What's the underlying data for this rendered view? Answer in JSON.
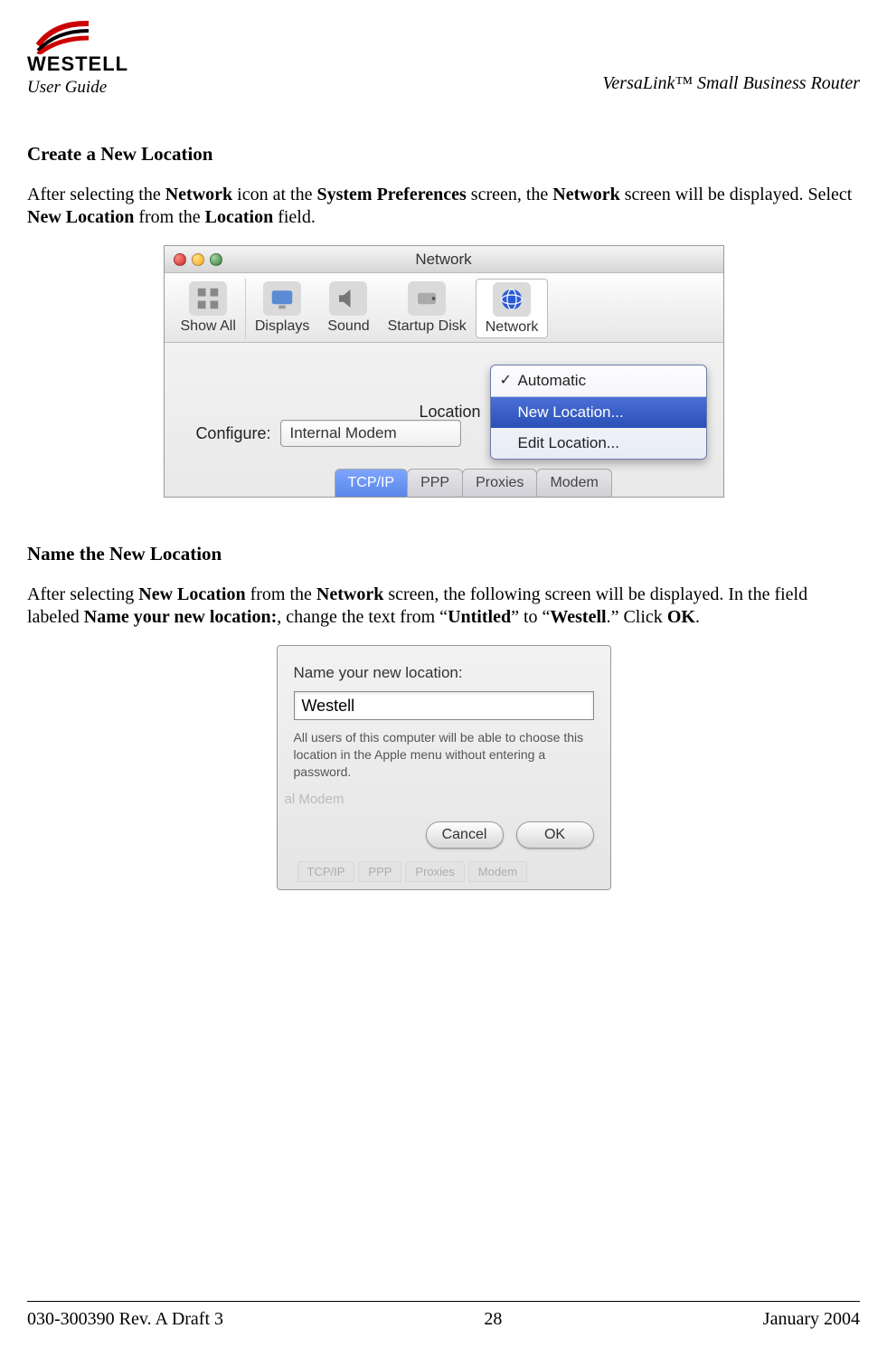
{
  "header": {
    "brand": "WESTELL",
    "userGuide": " User Guide",
    "product": "VersaLink™  Small Business Router"
  },
  "section1": {
    "title": "Create a New Location",
    "p_1": "After selecting the ",
    "p_b1": "Network",
    "p_2": " icon at the ",
    "p_b2": "System Preferences",
    "p_3": " screen, the ",
    "p_b3": "Network",
    "p_4": " screen will be displayed. Select ",
    "p_b4": "New Location",
    "p_5": " from the ",
    "p_b5": "Location",
    "p_6": " field."
  },
  "netwin": {
    "title": "Network",
    "toolbar": {
      "showAll": "Show All",
      "displays": "Displays",
      "sound": "Sound",
      "startupDisk": "Startup Disk",
      "network": "Network"
    },
    "locationLabel": "Location",
    "configureLabel": "Configure:",
    "configureValue": "Internal Modem",
    "dropdown": {
      "automatic": "Automatic",
      "newLocation": "New Location...",
      "editLocation": "Edit Location..."
    },
    "tabs": {
      "tcpip": "TCP/IP",
      "ppp": "PPP",
      "proxies": "Proxies",
      "modem": "Modem"
    }
  },
  "section2": {
    "title": "Name the New Location",
    "p_1": "After selecting ",
    "p_b1": "New Location",
    "p_2": " from the ",
    "p_b2": "Network",
    "p_3": " screen, the following screen will be displayed. In the field labeled ",
    "p_b3": "Name your new location:",
    "p_4": ", change the text from “",
    "p_b4": "Untitled",
    "p_5": "” to “",
    "p_b5": "Westell",
    "p_6": ".” Click ",
    "p_b6": "OK",
    "p_7": "."
  },
  "namedlg": {
    "label": "Name your new location:",
    "value": "Westell",
    "help": "All users of this computer will be able to choose this location in the Apple menu without entering a password.",
    "ghost": "al Modem",
    "cancel": "Cancel",
    "ok": "OK",
    "ghostTabs": {
      "a": "TCP/IP",
      "b": "PPP",
      "c": "Proxies",
      "d": "Modem"
    }
  },
  "footer": {
    "left": "030-300390 Rev. A Draft 3",
    "center": "28",
    "right": "January 2004"
  }
}
